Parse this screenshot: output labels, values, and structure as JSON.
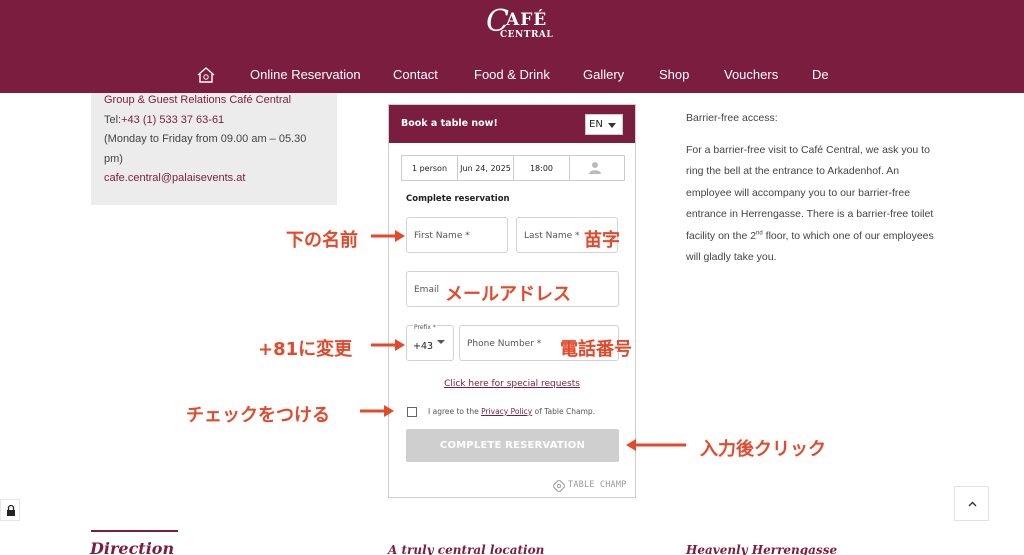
{
  "header": {
    "logo_cafe": "AFÉ",
    "logo_c": "C",
    "logo_central": "CENTRAL",
    "nav": [
      {
        "label": "Online Reservation"
      },
      {
        "label": "Contact"
      },
      {
        "label": "Food & Drink"
      },
      {
        "label": "Gallery"
      },
      {
        "label": "Shop"
      },
      {
        "label": "Vouchers"
      },
      {
        "label": "De"
      }
    ]
  },
  "contact": {
    "line1": "Group & Guest Relations Café Central",
    "phone_prefix": "Tel:",
    "phone": "+43 (1) 533 37 63-61",
    "hours": "(Monday to Friday from 09.00 am – 05.30 pm)",
    "email": "cafe.central@palaisevents.at"
  },
  "widget": {
    "title": "Book a table now!",
    "language": "EN",
    "persons": "1 person",
    "date": "Jun 24, 2025",
    "time": "18:00",
    "section_title": "Complete reservation",
    "first_name_placeholder": "First Name *",
    "last_name_placeholder": "Last Name *",
    "email_placeholder": "Email",
    "prefix_label": "Prefix *",
    "prefix_value": "+43",
    "phone_placeholder": "Phone Number *",
    "special_requests": "Click here for special requests",
    "agree_pre": "I agree to the ",
    "agree_link": "Privacy Policy",
    "agree_post": " of Table Champ.",
    "complete_button": "COMPLETE RESERVATION",
    "powered_by": "TABLE CHAMP"
  },
  "right": {
    "barrier_title": "Barrier-free access:",
    "para_1": "For a barrier-free visit to Café Central, we ask you to ring the bell at the entrance to Arkadenhof. An employee will accompany you to our barrier-free entrance in Herrengasse. There is a barrier-free toilet facility on the 2",
    "para_sup": "nd",
    "para_2": " floor, to which one of our employees will gladly take you."
  },
  "annotations": {
    "first_name": "下の名前",
    "last_name": "苗字",
    "email": "メールアドレス",
    "prefix": "+81に変更",
    "phone": "電話番号",
    "check": "チェックをつける",
    "click": "入力後クリック"
  },
  "bottom": {
    "h1": "Direction",
    "h2": "A truly central location",
    "h3": "Heavenly Herrengasse"
  },
  "colors": {
    "brand": "#7a1d3e",
    "annotation": "#e34a2b"
  }
}
